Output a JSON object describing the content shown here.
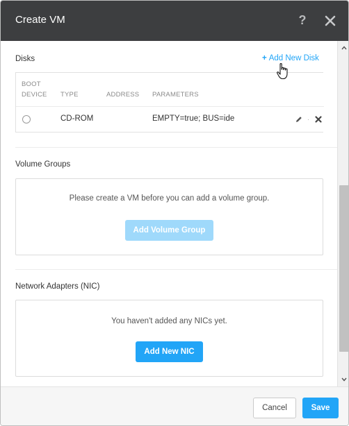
{
  "dialog": {
    "title": "Create VM",
    "help_icon": "question-icon",
    "close_icon": "close-icon"
  },
  "disks": {
    "section_label": "Disks",
    "add_label": "Add New Disk",
    "add_icon": "plus-icon",
    "columns": [
      "BOOT",
      "DEVICE",
      "TYPE",
      "ADDRESS",
      "PARAMETERS"
    ],
    "rows": [
      {
        "type": "CD-ROM",
        "address": "",
        "parameters": "EMPTY=true; BUS=ide"
      }
    ],
    "row_separator": "·"
  },
  "volume_groups": {
    "section_label": "Volume Groups",
    "message": "Please create a VM before you can add a volume group.",
    "button_label": "Add Volume Group"
  },
  "nics": {
    "section_label": "Network Adapters (NIC)",
    "message": "You haven't added any NICs yet.",
    "button_label": "Add New NIC"
  },
  "footer": {
    "cancel_label": "Cancel",
    "save_label": "Save"
  },
  "colors": {
    "header_bg": "#3d3e40",
    "accent": "#22a5f7",
    "accent_disabled": "#9fd9fb"
  }
}
